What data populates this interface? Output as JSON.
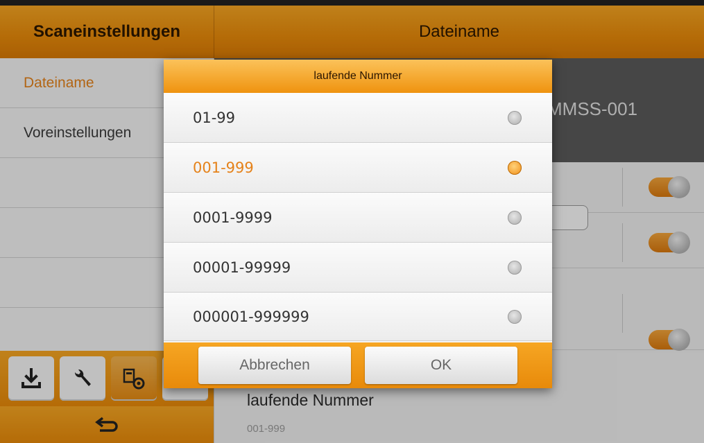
{
  "header": {
    "left_title": "Scaneinstellungen",
    "right_title": "Dateiname"
  },
  "sidebar": {
    "items": [
      {
        "label": "Dateiname",
        "active": true
      },
      {
        "label": "Voreinstellungen",
        "active": false
      },
      {
        "label": ""
      },
      {
        "label": ""
      },
      {
        "label": ""
      },
      {
        "label": ""
      }
    ],
    "toolbar_icons": [
      "download-icon",
      "wrench-icon",
      "scanner-settings-icon",
      "gear-icon"
    ],
    "back_icon": "back-arrow-icon"
  },
  "main": {
    "preview_text": "MMSS-001",
    "bottom_title": "laufende Nummer",
    "bottom_value": "001-999"
  },
  "dialog": {
    "title": "laufende Nummer",
    "options": [
      "01-99",
      "001-999",
      "0001-9999",
      "00001-99999",
      "000001-999999"
    ],
    "selected_index": 1,
    "cancel_label": "Abbrechen",
    "ok_label": "OK"
  },
  "colors": {
    "accent": "#e88a0a",
    "selected_text": "#e5821a"
  }
}
